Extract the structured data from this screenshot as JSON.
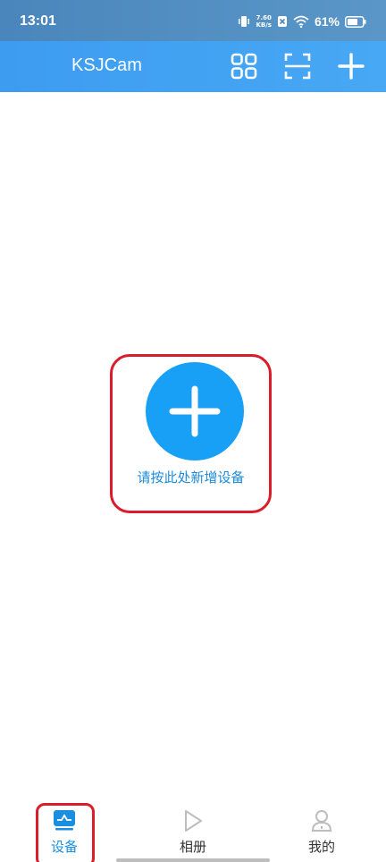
{
  "status_bar": {
    "time": "13:01",
    "net_speed_value": "7.60",
    "net_speed_unit": "KB/s",
    "battery_percent": "61%",
    "icons": [
      "vibrate-icon",
      "sim-off-icon",
      "wifi-icon",
      "battery-icon"
    ]
  },
  "app_bar": {
    "title": "KSJCam",
    "actions": [
      "grid-view-icon",
      "scan-icon",
      "add-icon"
    ]
  },
  "main": {
    "add_device_label": "请按此处新增设备"
  },
  "tabs": [
    {
      "label": "设备",
      "icon": "device-icon",
      "active": true
    },
    {
      "label": "相册",
      "icon": "play-icon",
      "active": false
    },
    {
      "label": "我的",
      "icon": "person-icon",
      "active": false
    }
  ],
  "colors": {
    "app_bar": "#3d9cf0",
    "status_bar": "#4a86bb",
    "accent": "#18a0f6",
    "highlight_outline": "#d91d2a"
  }
}
